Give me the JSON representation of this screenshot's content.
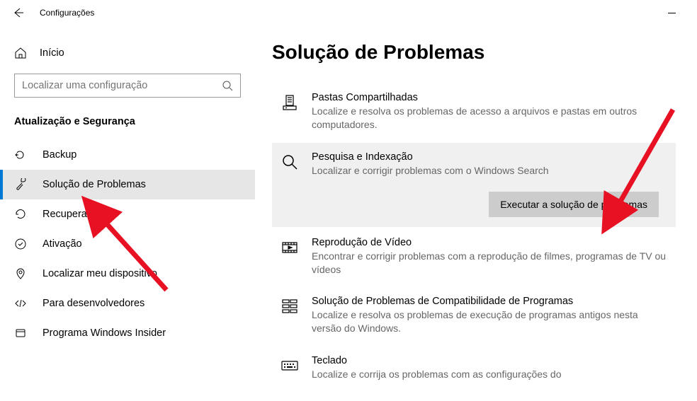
{
  "titlebar": {
    "title": "Configurações"
  },
  "sidebar": {
    "home_label": "Início",
    "search_placeholder": "Localizar uma configuração",
    "category": "Atualização e Segurança",
    "items": [
      {
        "label": "Backup"
      },
      {
        "label": "Solução de Problemas"
      },
      {
        "label": "Recuperação"
      },
      {
        "label": "Ativação"
      },
      {
        "label": "Localizar meu dispositivo"
      },
      {
        "label": "Para desenvolvedores"
      },
      {
        "label": "Programa Windows Insider"
      }
    ]
  },
  "main": {
    "title": "Solução de Problemas",
    "troubleshooters": [
      {
        "title": "Pastas Compartilhadas",
        "desc": "Localize e resolva os problemas de acesso a arquivos e pastas em outros computadores."
      },
      {
        "title": "Pesquisa e Indexação",
        "desc": "Localizar e corrigir problemas com o Windows Search"
      },
      {
        "title": "Reprodução de Vídeo",
        "desc": "Encontrar e corrigir problemas com a reprodução de filmes, programas de TV ou vídeos"
      },
      {
        "title": "Solução de Problemas de Compatibilidade de Programas",
        "desc": "Localize e resolva os problemas de execução de programas antigos nesta versão do Windows."
      },
      {
        "title": "Teclado",
        "desc": "Localize e corrija os problemas com as configurações do"
      }
    ],
    "run_button": "Executar a solução de problemas"
  }
}
